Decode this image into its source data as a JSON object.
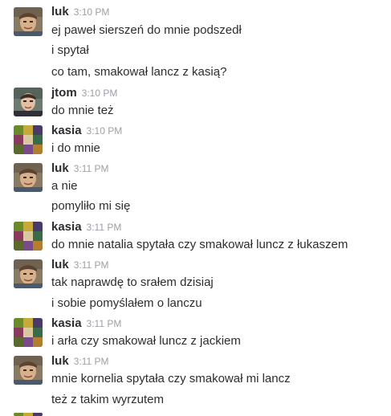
{
  "messages": [
    {
      "author": "luk",
      "time": "3:10 PM",
      "avatar": "luk",
      "lines": [
        "ej paweł sierszeń do mnie podszedł",
        "i spytał",
        "co tam, smakował lancz z kasią?"
      ]
    },
    {
      "author": "jtom",
      "time": "3:10 PM",
      "avatar": "jtom",
      "lines": [
        "do mnie też"
      ]
    },
    {
      "author": "kasia",
      "time": "3:10 PM",
      "avatar": "kasia",
      "lines": [
        "i do mnie"
      ]
    },
    {
      "author": "luk",
      "time": "3:11 PM",
      "avatar": "luk",
      "lines": [
        "a nie",
        "pomyliło mi się"
      ]
    },
    {
      "author": "kasia",
      "time": "3:11 PM",
      "avatar": "kasia",
      "lines": [
        "do mnie natalia spytała czy smakował luncz z łukaszem"
      ]
    },
    {
      "author": "luk",
      "time": "3:11 PM",
      "avatar": "luk",
      "lines": [
        "tak naprawdę to srałem dzisiaj",
        "i sobie pomyślałem o lanczu"
      ]
    },
    {
      "author": "kasia",
      "time": "3:11 PM",
      "avatar": "kasia",
      "lines": [
        "i arła czy smakował luncz z jackiem"
      ]
    },
    {
      "author": "luk",
      "time": "3:11 PM",
      "avatar": "luk",
      "lines": [
        "mnie kornelia spytała czy smakował mi lancz",
        "też z takim wyrzutem"
      ]
    }
  ]
}
